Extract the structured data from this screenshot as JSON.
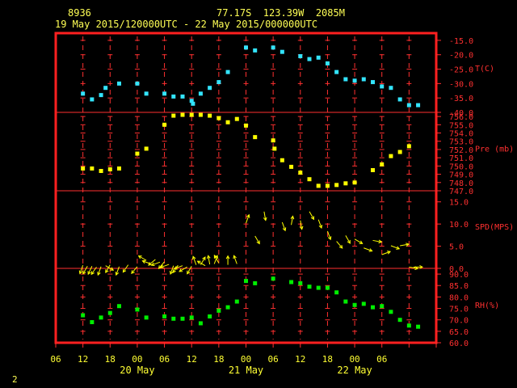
{
  "header": {
    "station_id": "8936",
    "location": "77.17S  123.39W  2085M",
    "period": "19 May 2015/120000UTC - 22 May 2015/000000UTC"
  },
  "footer": {
    "page_number": "2"
  },
  "colors": {
    "frame": "#ff2020",
    "grid": "#ff3030",
    "label": "#ffff33",
    "temperature": "#33e5ff",
    "pressure": "#ffff00",
    "wind": "#ffff00",
    "humidity": "#00ee00"
  },
  "chart_data": [
    {
      "type": "scatter",
      "panel": "temperature",
      "ylabel": "T(C)",
      "ylim": [
        -40,
        -12.5
      ],
      "yticks": [
        -15,
        -20,
        -25,
        -30,
        -35,
        -40
      ],
      "ytick_labels": [
        "-15.0",
        "-20.0",
        "-25.0",
        "-30.0",
        "-35.0",
        "-40.0"
      ],
      "x": [
        12,
        14,
        16,
        17,
        20,
        24,
        26,
        30,
        32,
        34,
        36,
        36.3,
        38,
        40,
        42,
        44,
        48,
        50,
        54,
        56,
        60,
        62,
        64,
        66,
        68,
        70,
        72,
        74,
        76,
        78,
        80,
        82,
        84,
        86
      ],
      "y": [
        -33.5,
        -35.5,
        -34,
        -31.5,
        -30,
        -30,
        -33.5,
        -33.5,
        -34.5,
        -34.5,
        -36,
        -37,
        -33.5,
        -31.5,
        -29.5,
        -26,
        -17.5,
        -18.5,
        -17.5,
        -19,
        -20.5,
        -21.5,
        -21,
        -23,
        -26,
        -28.5,
        -29,
        -28.5,
        -29.5,
        -31,
        -31.5,
        -35.5,
        -37.5,
        -37.5
      ]
    },
    {
      "type": "scatter",
      "panel": "pressure",
      "ylabel": "Pre (mb)",
      "ylim": [
        747,
        756.5
      ],
      "yticks": [
        756,
        755,
        754,
        753,
        752,
        751,
        750,
        749,
        748,
        747
      ],
      "ytick_labels": [
        "756.0",
        "755.0",
        "754.0",
        "753.0",
        "752.0",
        "751.0",
        "750.0",
        "749.0",
        "748.0",
        "747.0"
      ],
      "x": [
        12,
        14,
        16,
        18,
        20,
        24,
        26,
        30,
        32,
        34,
        36,
        38,
        40,
        42,
        44,
        46,
        48,
        50,
        54,
        54.3,
        56,
        58,
        60,
        62,
        64,
        66,
        68,
        70,
        72,
        76,
        78,
        80,
        82,
        84
      ],
      "y": [
        749.7,
        749.7,
        749.4,
        749.6,
        749.7,
        751.5,
        752.1,
        755,
        756.1,
        756.2,
        756.2,
        756.2,
        756.1,
        755.8,
        755.3,
        755.7,
        754.9,
        753.5,
        753.1,
        752.1,
        750.7,
        749.9,
        749.2,
        748.4,
        747.6,
        747.6,
        747.7,
        747.9,
        748,
        749.5,
        750.2,
        751.2,
        751.7,
        752.4
      ]
    },
    {
      "type": "vector",
      "panel": "wind",
      "ylabel": "SPD(MPS)",
      "ylim": [
        0,
        17.5
      ],
      "yticks": [
        15,
        10,
        5,
        0
      ],
      "ytick_labels": [
        "15.0",
        "10.0",
        "5.0",
        "0.0"
      ],
      "x": [
        12,
        13,
        14,
        15,
        16,
        17,
        18,
        20,
        22,
        24,
        26,
        27,
        28,
        29,
        30,
        31,
        32,
        33,
        34,
        35,
        36,
        37,
        38,
        39,
        40,
        41,
        42,
        44,
        46,
        48,
        50,
        52,
        56,
        58,
        60,
        62,
        64,
        66,
        68,
        70,
        72,
        74,
        76,
        78,
        80,
        82,
        84,
        85
      ],
      "speed": [
        0.7,
        0.5,
        0.5,
        0.3,
        0.4,
        0.6,
        0.8,
        0.4,
        0.8,
        0.4,
        1.8,
        1,
        2,
        1.4,
        1.5,
        0.9,
        0.6,
        0.7,
        0.6,
        0.3,
        0.5,
        0.8,
        0.8,
        0.6,
        0.9,
        1.0,
        1.2,
        0.8,
        1.0,
        10.2,
        7.3,
        12.8,
        10.4,
        9.8,
        10.8,
        12.8,
        11.0,
        8.4,
        6.1,
        7.4,
        6.6,
        4.6,
        6.3,
        3.1,
        5.1,
        5.1,
        0.3,
        0.3
      ],
      "direction_note": "arrow heads"
    },
    {
      "type": "scatter",
      "panel": "humidity",
      "ylabel": "RH(%)",
      "ylim": [
        60,
        92.5
      ],
      "yticks": [
        90,
        85,
        80,
        75,
        70,
        65,
        60
      ],
      "ytick_labels": [
        "90.0",
        "85.0",
        "80.0",
        "75.0",
        "70.0",
        "65.0",
        "60.0"
      ],
      "x": [
        12,
        14,
        16,
        18,
        20,
        24,
        26,
        30,
        32,
        34,
        36,
        38,
        40,
        42,
        44,
        46,
        48,
        50,
        54,
        58,
        60,
        62,
        64,
        66,
        68,
        70,
        72,
        74,
        76,
        78,
        80,
        82,
        84,
        86
      ],
      "y": [
        72,
        69,
        71,
        73,
        76,
        74.5,
        71,
        71.5,
        70.5,
        70.5,
        71,
        68.5,
        71.5,
        74,
        75.5,
        78,
        87,
        86,
        88,
        86.5,
        86,
        84.5,
        84,
        84,
        82,
        78,
        76.5,
        77,
        75.5,
        76,
        73.5,
        70,
        67.5,
        67
      ]
    }
  ],
  "x_axis": {
    "xlim": [
      6,
      90
    ],
    "tick_hours": [
      6,
      12,
      18,
      24,
      30,
      36,
      42,
      48,
      54,
      60,
      66,
      72,
      78,
      84,
      90
    ],
    "tick_labels": [
      "06",
      "12",
      "18",
      "00",
      "06",
      "12",
      "18",
      "00",
      "06",
      "12",
      "18",
      "00",
      "06"
    ],
    "date_labels": [
      "20 May",
      "21 May",
      "22 May"
    ]
  }
}
